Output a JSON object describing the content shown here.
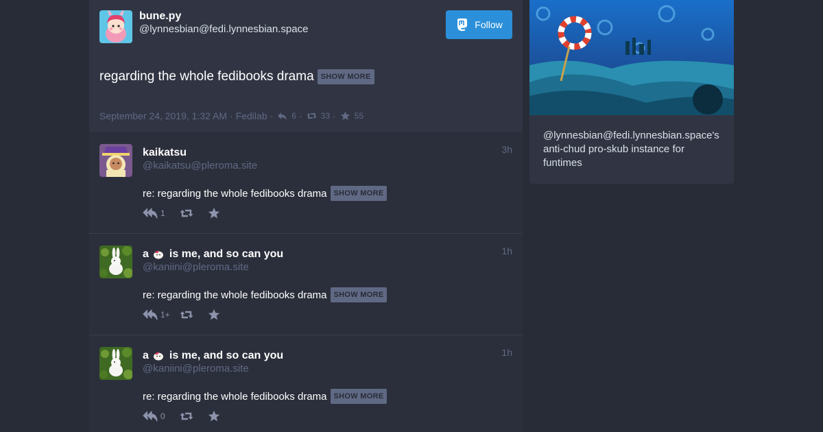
{
  "status": {
    "display_name": "bune.py",
    "acct": "@lynnesbian@fedi.lynnesbian.space",
    "follow_label": "Follow",
    "content": "regarding the whole fedibooks drama",
    "show_more_label": "SHOW MORE",
    "timestamp": "September 24, 2019, 1:32 AM",
    "application": "Fedilab",
    "replies_count": "6",
    "boosts_count": "33",
    "favourites_count": "55"
  },
  "replies": [
    {
      "display_name": "kaikatsu",
      "acct": "@kaikatsu@pleroma.site",
      "time": "3h",
      "content": "re: regarding the whole fedibooks drama",
      "show_more_label": "SHOW MORE",
      "reply_count": "1"
    },
    {
      "display_name_prefix": "a",
      "display_name_suffix": "is me, and so can you",
      "acct": "@kaniini@pleroma.site",
      "time": "1h",
      "content": "re: regarding the whole fedibooks drama",
      "show_more_label": "SHOW MORE",
      "reply_count": "1+"
    },
    {
      "display_name_prefix": "a",
      "display_name_suffix": "is me, and so can you",
      "acct": "@kaniini@pleroma.site",
      "time": "1h",
      "content": "re: regarding the whole fedibooks drama",
      "show_more_label": "SHOW MORE",
      "reply_count": "0"
    }
  ],
  "sidebar": {
    "description": "@lynnesbian@fedi.lynnesbian.space's anti-chud pro-skub instance for funtimes"
  },
  "icons": {
    "follow": "mastodon-logo-icon",
    "reply": "reply-icon",
    "boost": "boost-icon",
    "favourite": "star-icon",
    "emoji": "blob-emoji-icon"
  },
  "colors": {
    "accent": "#2b90d9",
    "background": "#282c37",
    "card": "#313543",
    "muted_text": "#606984"
  }
}
